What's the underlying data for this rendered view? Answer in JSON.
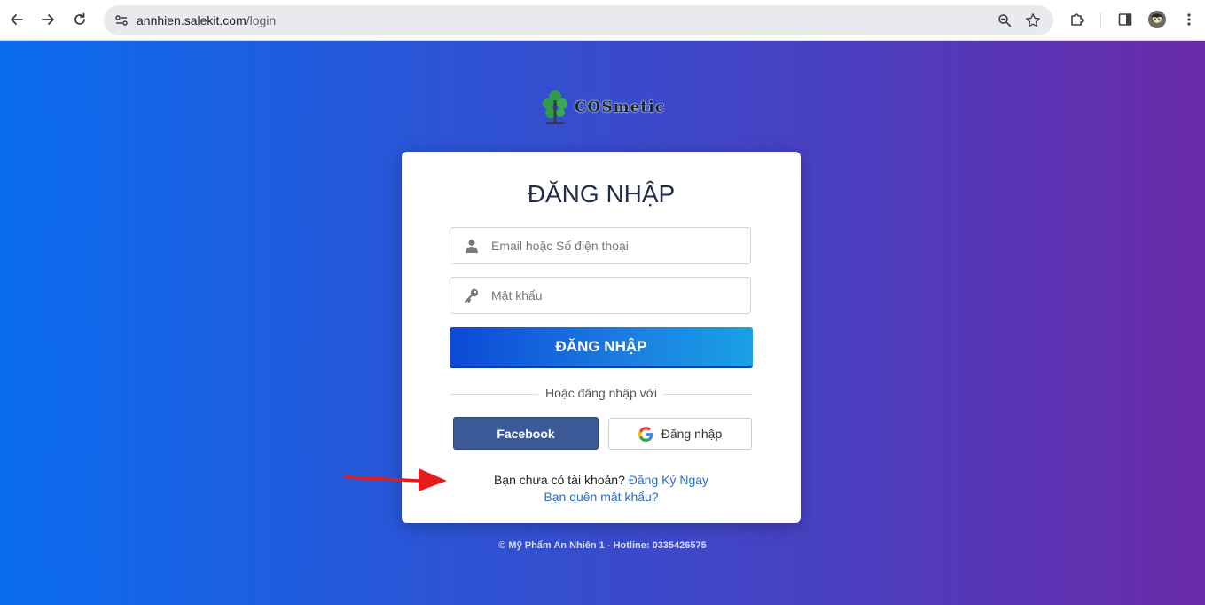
{
  "browser": {
    "url_host": "annhien.salekit.com",
    "url_path": "/login"
  },
  "icons": {
    "back": "back-arrow-icon",
    "forward": "forward-arrow-icon",
    "reload": "reload-icon",
    "site_info": "tune-icon",
    "zoom": "zoom-icon",
    "bookmark": "star-icon",
    "extensions": "puzzle-icon",
    "side_panel": "side-panel-icon",
    "profile": "avatar",
    "menu": "kebab-menu-icon",
    "user": "user-icon",
    "key": "key-icon",
    "google": "google-g-icon",
    "annotation": "red-arrow-icon"
  },
  "logo": {
    "text": "COSmetic"
  },
  "login": {
    "title": "ĐĂNG NHẬP",
    "email_placeholder": "Email hoặc Số điện thoại",
    "password_placeholder": "Mật khẩu",
    "submit_label": "ĐĂNG NHẬP",
    "divider_text": "Hoặc đăng nhập với",
    "facebook_label": "Facebook",
    "google_label": "Đăng nhập",
    "signup_prompt": "Bạn chưa có tài khoản?",
    "signup_link": "Đăng Ký Ngay",
    "forgot_link": "Bạn quên mật khẩu?"
  },
  "footer": {
    "text": "© Mỹ Phẩm An Nhiên 1 - Hotline: 0335426575"
  },
  "colors": {
    "facebook": "#3b5997",
    "link": "#2a6bc4",
    "arrow": "#e41b1b"
  }
}
